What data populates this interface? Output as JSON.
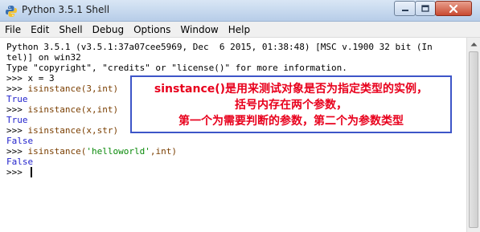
{
  "window": {
    "title": "Python 3.5.1 Shell",
    "icons": {
      "app": "python-icon",
      "minimize": "minimize-icon",
      "maximize": "maximize-icon",
      "close": "close-icon"
    }
  },
  "menu": {
    "items": [
      "File",
      "Edit",
      "Shell",
      "Debug",
      "Options",
      "Window",
      "Help"
    ]
  },
  "shell": {
    "banner_1": "Python 3.5.1 (v3.5.1:37a07cee5969, Dec  6 2015, 01:38:48) [MSC v.1900 32 bit (In",
    "banner_2": "tel)] on win32",
    "banner_3": "Type \"copyright\", \"credits\" or \"license()\" for more information.",
    "prompt": ">>> ",
    "lines": [
      {
        "cmd": "x = 3"
      },
      {
        "cmd": "isinstance(3,int)",
        "out": "True"
      },
      {
        "cmd": "isinstance(x,int)",
        "out": "True"
      },
      {
        "cmd": "isinstance(x,str)",
        "out": "False"
      },
      {
        "call_pre": "isinstance(",
        "str": "'helloworld'",
        "call_post": ",int)",
        "out": "False"
      }
    ]
  },
  "annotation": {
    "line1": "sinstance()是用来测试对象是否为指定类型的实例，",
    "line2": "括号内存在两个参数，",
    "line3": "第一个为需要判断的参数，第二个为参数类型",
    "color": "#e8001c",
    "border_color": "#3d55c8"
  },
  "colors": {
    "prompt": "#7a3e00",
    "output": "#2222cc",
    "string": "#0a8a0a"
  }
}
